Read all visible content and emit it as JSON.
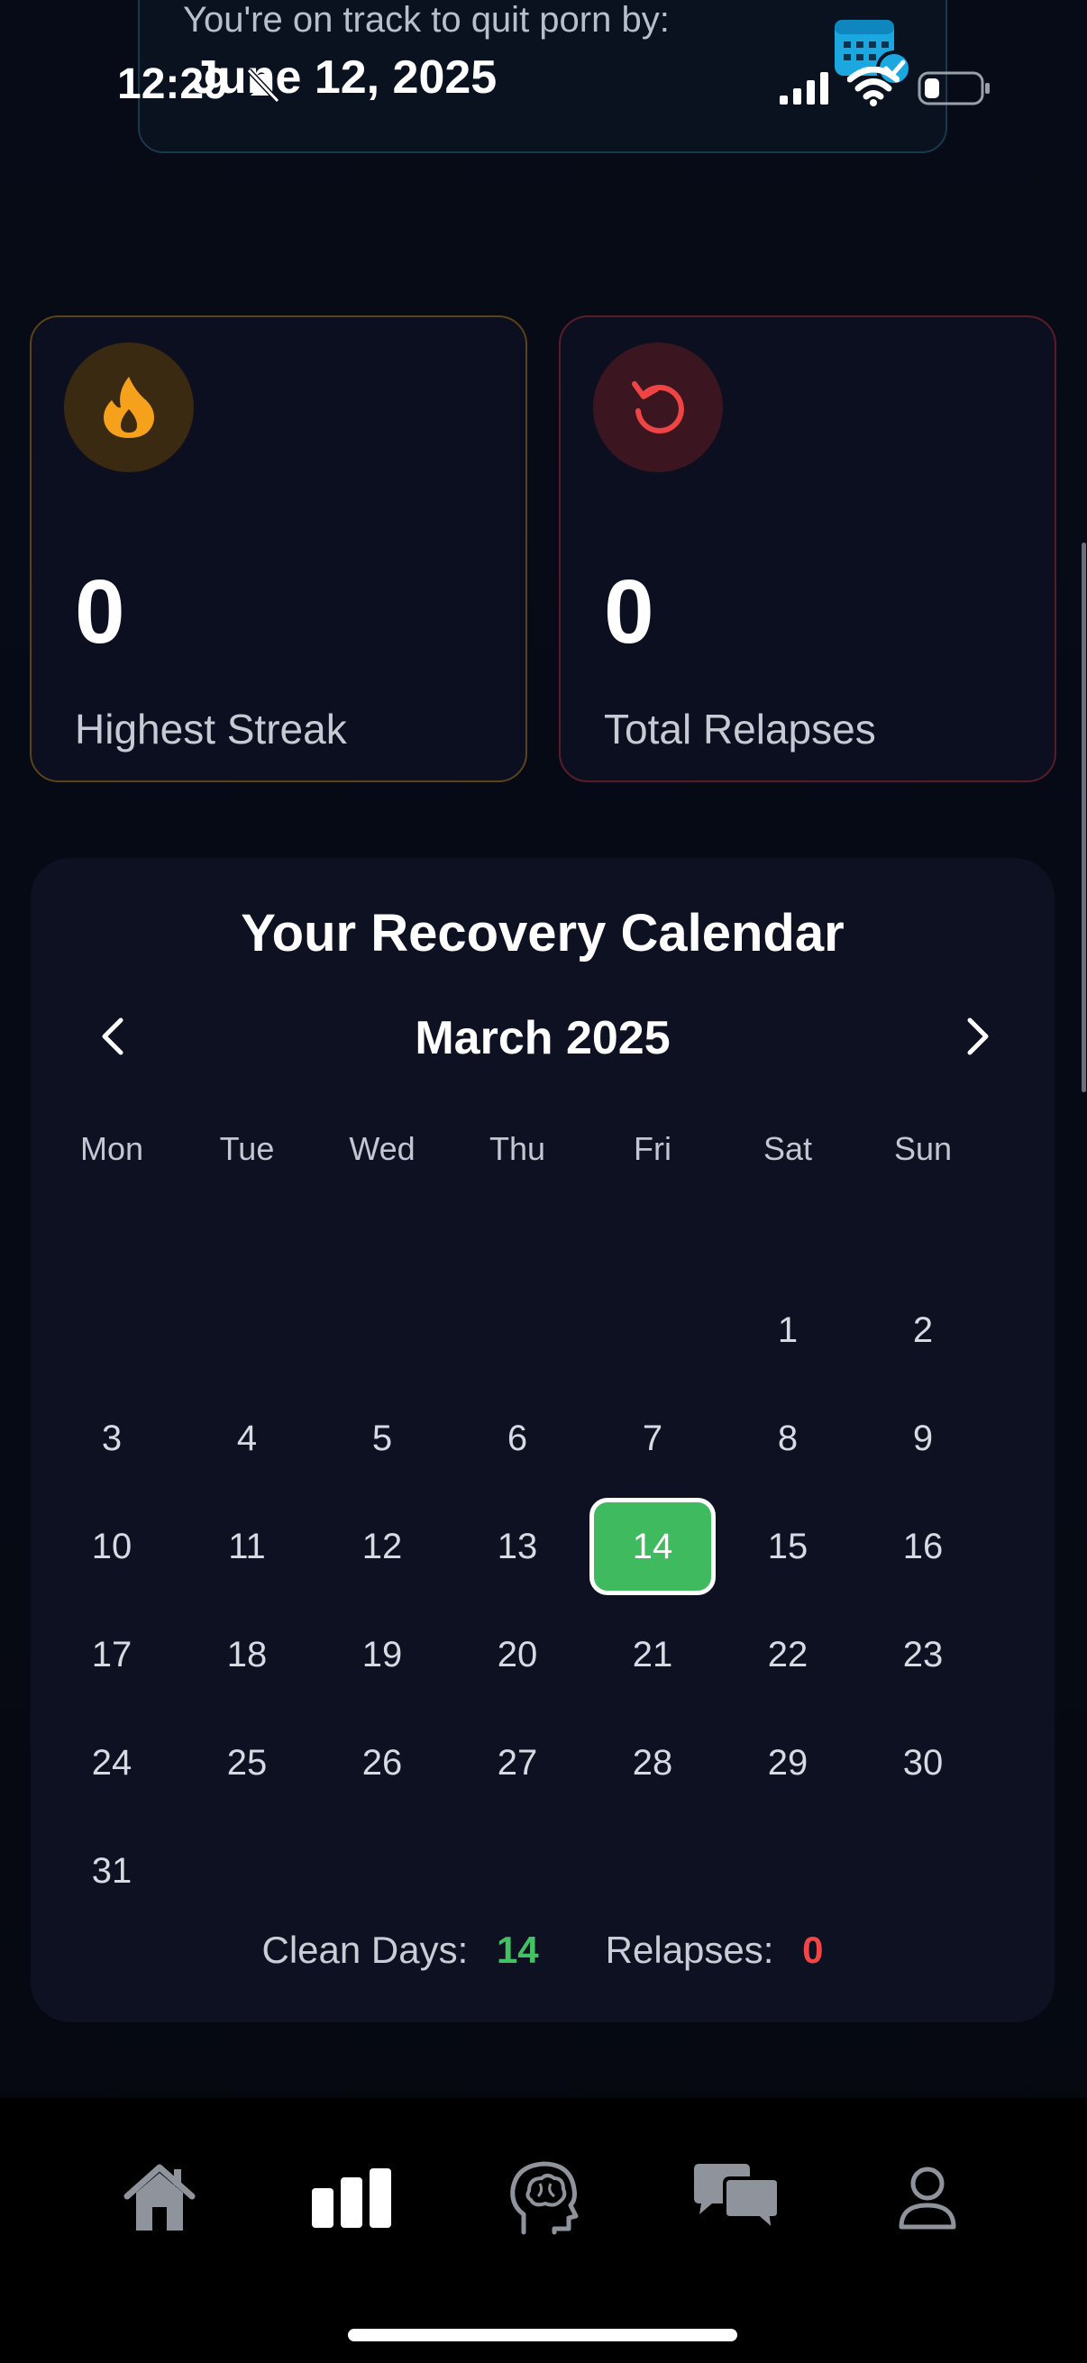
{
  "status_bar": {
    "time": "12:29"
  },
  "track_card": {
    "text": "You're on track to quit porn by:",
    "date": "June 12, 2025"
  },
  "stats": {
    "highest_streak": {
      "value": "0",
      "label": "Highest Streak",
      "icon": "flame-icon",
      "accent": "#f5a623"
    },
    "total_relapses": {
      "value": "0",
      "label": "Total Relapses",
      "icon": "reset-icon",
      "accent": "#ef4444"
    }
  },
  "calendar": {
    "title": "Your Recovery Calendar",
    "month": "March 2025",
    "weekdays": [
      "Mon",
      "Tue",
      "Wed",
      "Thu",
      "Fri",
      "Sat",
      "Sun"
    ],
    "first_weekday_index": 5,
    "days_in_month": 31,
    "clean_days_marked": [
      14
    ],
    "clean_color": "#3fba5e",
    "summary": {
      "clean_label": "Clean Days:",
      "clean_value": "14",
      "relapse_label": "Relapses:",
      "relapse_value": "0"
    }
  },
  "bottom_nav": {
    "items": [
      {
        "icon": "home-icon",
        "active": false
      },
      {
        "icon": "stats-icon",
        "active": true
      },
      {
        "icon": "brain-icon",
        "active": false
      },
      {
        "icon": "chat-icon",
        "active": false
      },
      {
        "icon": "profile-icon",
        "active": false
      }
    ]
  }
}
